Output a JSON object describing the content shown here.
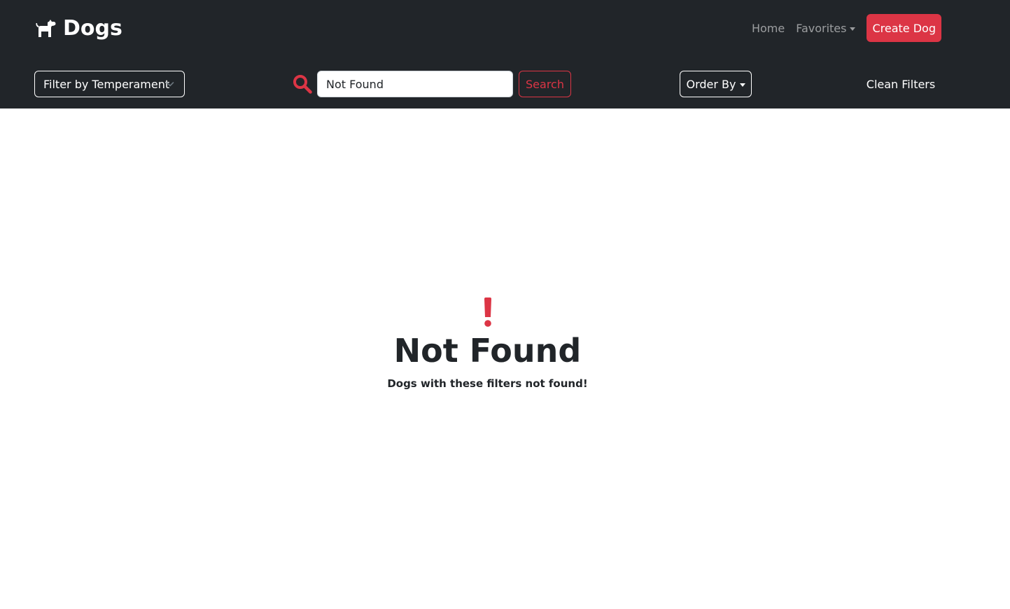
{
  "brand": {
    "name": "Dogs",
    "icon": "dog-icon"
  },
  "nav": {
    "home_label": "Home",
    "favorites_label": "Favorites",
    "create_label": "Create Dog"
  },
  "filters": {
    "temperament_label": "Filter by Temperament",
    "search": {
      "value": "Not Found",
      "button_label": "Search",
      "icon": "search-icon"
    },
    "order_label": "Order By",
    "clean_label": "Clean Filters"
  },
  "empty_state": {
    "icon": "exclamation-icon",
    "title": "Not Found",
    "message": "Dogs with these filters not found!"
  },
  "colors": {
    "navbar": "#212529",
    "accent": "#dc3545",
    "text": "#212529"
  }
}
